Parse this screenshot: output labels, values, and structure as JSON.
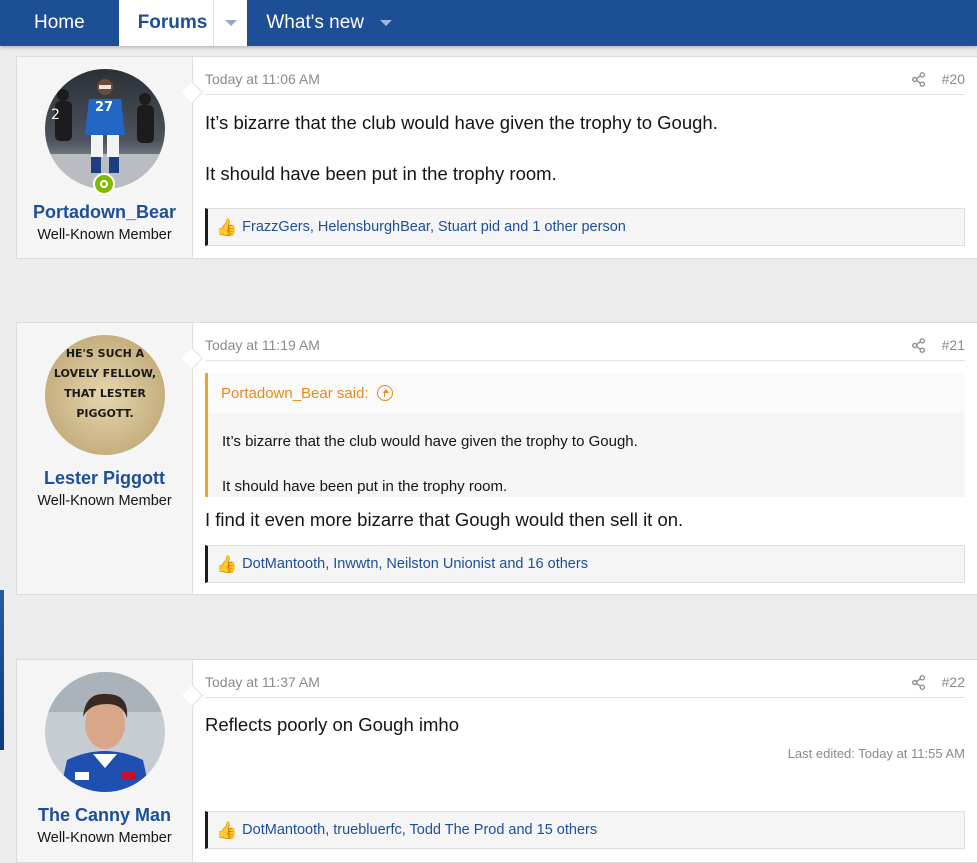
{
  "nav": {
    "home_label": "Home",
    "forums_label": "Forums",
    "whats_new_label": "What's new"
  },
  "colors": {
    "nav_bg": "#1d4f97",
    "username": "#1d4f97",
    "online": "#7fb900",
    "quote_accent": "#f0a424"
  },
  "posts": [
    {
      "username": "Portadown_Bear",
      "user_title": "Well-Known Member",
      "online": true,
      "time": "Today at 11:06 AM",
      "number": "#20",
      "lines": [
        "It’s bizarre that the club would have given the trophy to Gough.",
        "It should have been put in the trophy room."
      ],
      "reactions": "FrazzGers, HelensburghBear, Stuart pid and 1 other person",
      "avatar_icon": "football-player-avatar-icon"
    },
    {
      "username": "Lester Piggott",
      "user_title": "Well-Known Member",
      "time": "Today at 11:19 AM",
      "number": "#21",
      "avatar_lines": [
        "HE'S SUCH A",
        "LOVELY FELLOW,",
        "THAT LESTER",
        "PIGGOTT."
      ],
      "quote": {
        "author": "Portadown_Bear said:",
        "lines": [
          "It’s bizarre that the club would have given the trophy to Gough.",
          "It should have been put in the trophy room."
        ]
      },
      "lines": [
        "I find it even more bizarre that Gough would then sell it on."
      ],
      "reactions": "DotMantooth, Inwwtn, Neilston Unionist and 16 others"
    },
    {
      "username": "The Canny Man",
      "user_title": "Well-Known Member",
      "time": "Today at 11:37 AM",
      "number": "#22",
      "lines": [
        "Reflects poorly on Gough imho"
      ],
      "last_edited": "Last edited: Today at 11:55 AM",
      "reactions": "DotMantooth, truebluerfc, Todd The Prod and 15 others",
      "avatar_icon": "footballer-portrait-avatar-icon"
    }
  ]
}
